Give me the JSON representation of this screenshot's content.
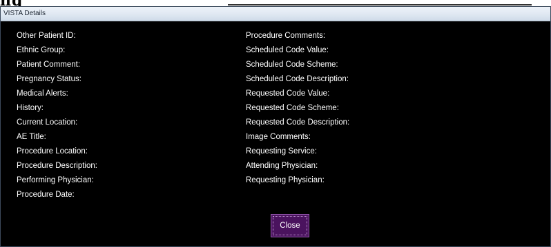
{
  "dialog": {
    "title": "VISTA Details"
  },
  "left_fields": [
    "Other Patient ID:",
    "Ethnic Group:",
    "Patient Comment:",
    "Pregnancy Status:",
    "Medical Alerts:",
    "History:",
    "Current Location:",
    "AE Title:",
    "Procedure Location:",
    "Procedure Description:",
    "Performing Physician:",
    "Procedure Date:"
  ],
  "right_fields": [
    "Procedure Comments:",
    "Scheduled Code Value:",
    "Scheduled Code Scheme:",
    "Scheduled Code Description:",
    "Requested Code Value:",
    "Requested Code Scheme:",
    "Requested Code Description:",
    "Image Comments:",
    "Requesting Service:",
    "Attending Physician:",
    "Requesting Physician:"
  ],
  "buttons": {
    "close_label": "Close"
  },
  "colors": {
    "dialog_background": "#000000",
    "text": "#ffffff",
    "close_button": "#4a135e"
  }
}
